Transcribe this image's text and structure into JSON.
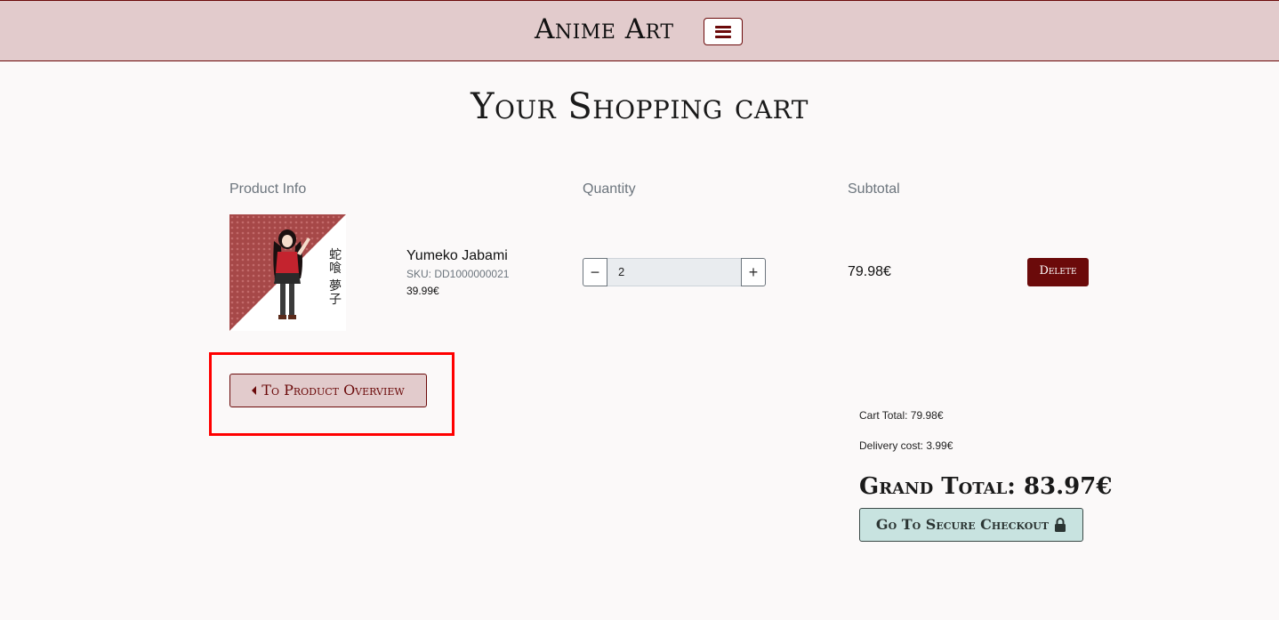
{
  "header": {
    "brand": "Anime Art",
    "menu_icon": "hamburger-menu-icon"
  },
  "page": {
    "title": "Your Shopping cart"
  },
  "table": {
    "headers": {
      "product_info": "Product Info",
      "quantity": "Quantity",
      "subtotal": "Subtotal"
    },
    "items": [
      {
        "name": "Yumeko Jabami",
        "sku": "SKU: DD1000000021",
        "price": "39.99€",
        "quantity": "2",
        "subtotal": "79.98€",
        "delete_label": "Delete",
        "image_text": [
          "蛇",
          "喰",
          "夢",
          "子"
        ]
      }
    ]
  },
  "stepper": {
    "minus": "−",
    "plus": "+"
  },
  "actions": {
    "overview_label": "To Product Overview",
    "checkout_label": "Go To Secure Checkout"
  },
  "totals": {
    "cart_total": "Cart Total: 79.98€",
    "delivery_cost": "Delivery cost: 3.99€",
    "grand_total": "Grand Total: 83.97€"
  },
  "colors": {
    "navbar_bg": "#e2cbcc",
    "brand_accent": "#6b0a0a",
    "checkout_bg": "#c8e3e0",
    "highlight": "#ff0000"
  }
}
